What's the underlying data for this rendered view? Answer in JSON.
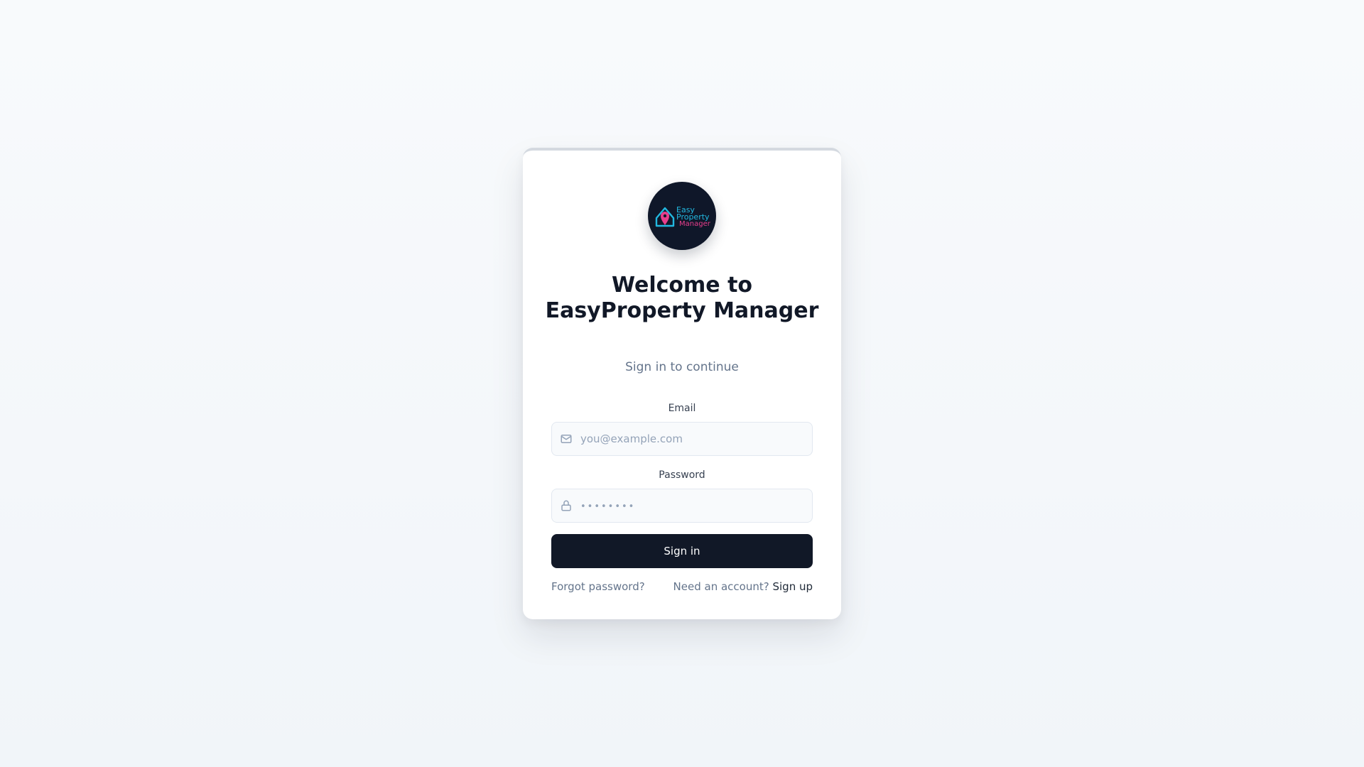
{
  "login": {
    "logo_alt": "Easy Property Manager",
    "logo_text": [
      "Easy",
      "Property",
      "Manager"
    ],
    "title": "Welcome to EasyProperty Manager",
    "subtitle": "Sign in to continue",
    "email": {
      "label": "Email",
      "placeholder": "you@example.com",
      "value": "",
      "icon": "mail-icon"
    },
    "password": {
      "label": "Password",
      "placeholder": "••••••••",
      "value": "",
      "icon": "lock-icon"
    },
    "submit_label": "Sign in",
    "forgot_label": "Forgot password?",
    "signup_prompt": "Need an account?",
    "signup_label": "Sign up"
  },
  "colors": {
    "background": "#f5f7fa",
    "card": "#ffffff",
    "primary_button": "#111827",
    "logo_background": "#0f1729",
    "logo_cyan": "#22b8e0",
    "logo_pink": "#e83e8c",
    "text_primary": "#111827",
    "text_muted": "#64748b"
  }
}
